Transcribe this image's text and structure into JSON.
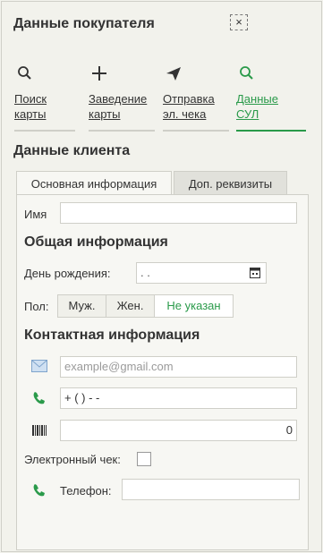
{
  "panel": {
    "title": "Данные покупателя",
    "close_glyph": "×"
  },
  "nav": [
    {
      "icon": "search-icon",
      "label": "Поиск\nкарты"
    },
    {
      "icon": "plus-icon",
      "label": "Заведение\nкарты"
    },
    {
      "icon": "send-icon",
      "label": "Отправка\nэл. чека"
    },
    {
      "icon": "search-icon",
      "label": "Данные\nСУЛ",
      "active": true
    }
  ],
  "client": {
    "title": "Данные клиента",
    "tabs": [
      "Основная информация",
      "Доп. реквизиты"
    ],
    "name_label": "Имя",
    "general_title": "Общая информация",
    "birthday_label": "День рождения:",
    "birthday_value": " .  .",
    "gender_label": "Пол:",
    "gender_options": [
      "Муж.",
      "Жен.",
      "Не указан"
    ],
    "gender_selected": "Не указан",
    "contact_title": "Контактная информация",
    "email_placeholder": "example@gmail.com",
    "phone_value": "+ (  )   -  -",
    "barcode_value": "0",
    "echeck_label": "Электронный чек:",
    "phone_label": "Телефон:"
  },
  "colors": {
    "accent": "#2a9a4a",
    "text": "#333333",
    "background": "#f2f2ec"
  }
}
